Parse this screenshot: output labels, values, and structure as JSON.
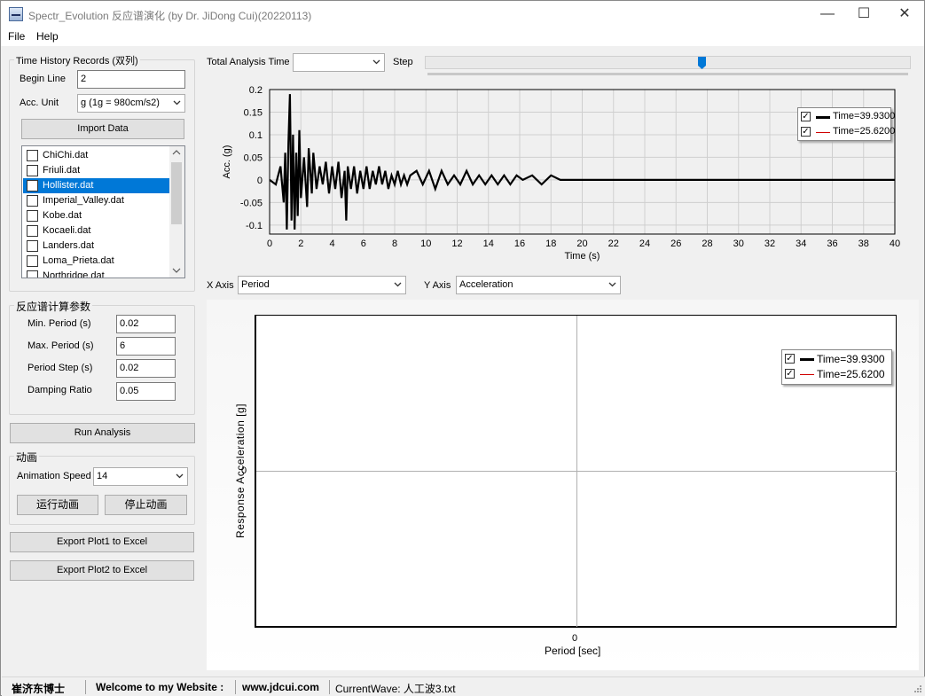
{
  "window": {
    "title": "Spectr_Evolution 反应谱演化 (by Dr. JiDong Cui)(20220113)",
    "controls": {
      "minimize": "—",
      "maximize": "☐",
      "close": "✕"
    }
  },
  "menu": {
    "items": [
      "File",
      "Help"
    ]
  },
  "time_history": {
    "group_title": "Time History Records (双列)",
    "begin_line_label": "Begin Line",
    "begin_line_value": "2",
    "acc_unit_label": "Acc. Unit",
    "acc_unit_value": "g (1g = 980cm/s2)",
    "import_button": "Import Data",
    "files": [
      {
        "name": "ChiChi.dat",
        "checked": false,
        "selected": false
      },
      {
        "name": "Friuli.dat",
        "checked": false,
        "selected": false
      },
      {
        "name": "Hollister.dat",
        "checked": false,
        "selected": true
      },
      {
        "name": "Imperial_Valley.dat",
        "checked": false,
        "selected": false
      },
      {
        "name": "Kobe.dat",
        "checked": false,
        "selected": false
      },
      {
        "name": "Kocaeli.dat",
        "checked": false,
        "selected": false
      },
      {
        "name": "Landers.dat",
        "checked": false,
        "selected": false
      },
      {
        "name": "Loma_Prieta.dat",
        "checked": false,
        "selected": false
      },
      {
        "name": "Northridge.dat",
        "checked": false,
        "selected": false
      }
    ]
  },
  "params": {
    "group_title": "反应谱计算参数",
    "min_period_label": "Min. Period (s)",
    "min_period_value": "0.02",
    "max_period_label": "Max. Period (s)",
    "max_period_value": "6",
    "period_step_label": "Period Step  (s)",
    "period_step_value": "0.02",
    "damping_label": "Damping Ratio",
    "damping_value": "0.05"
  },
  "run_button": "Run Analysis",
  "animation": {
    "group_title": "动画",
    "speed_label": "Animation Speed",
    "speed_value": "14",
    "run_button": "运行动画",
    "stop_button": "停止动画"
  },
  "export": {
    "plot1_button": "Export Plot1 to Excel",
    "plot2_button": "Export Plot2 to Excel"
  },
  "top_controls": {
    "total_time_label": "Total Analysis Time",
    "total_time_value": "",
    "step_label": "Step",
    "step_position": 0.57
  },
  "axis_selectors": {
    "x_label": "X Axis",
    "x_value": "Period",
    "y_label": "Y Axis",
    "y_value": "Acceleration"
  },
  "chart_data": [
    {
      "type": "line",
      "title": "",
      "xlabel": "Time (s)",
      "ylabel": "Acc. (g)",
      "xlim": [
        0,
        40
      ],
      "ylim": [
        -0.12,
        0.2
      ],
      "x_ticks": [
        "0",
        "2",
        "4",
        "6",
        "8",
        "10",
        "12",
        "14",
        "16",
        "18",
        "20",
        "22",
        "24",
        "26",
        "28",
        "30",
        "32",
        "34",
        "36",
        "38",
        "40"
      ],
      "y_ticks": [
        "0.2",
        "0.15",
        "0.1",
        "0.05",
        "0",
        "-0.05",
        "-0.1"
      ],
      "grid": true,
      "legend_position": "top-right",
      "series": [
        {
          "name": "Time=39.9300",
          "color": "#000000",
          "points": [
            [
              0,
              0
            ],
            [
              0.4,
              -0.01
            ],
            [
              0.7,
              0.03
            ],
            [
              0.9,
              -0.05
            ],
            [
              1.0,
              0.06
            ],
            [
              1.1,
              -0.11
            ],
            [
              1.2,
              0.08
            ],
            [
              1.3,
              0.19
            ],
            [
              1.4,
              -0.09
            ],
            [
              1.5,
              0.1
            ],
            [
              1.6,
              -0.11
            ],
            [
              1.7,
              0.06
            ],
            [
              1.8,
              -0.08
            ],
            [
              1.9,
              0.11
            ],
            [
              2.0,
              -0.04
            ],
            [
              2.2,
              0.05
            ],
            [
              2.4,
              -0.06
            ],
            [
              2.5,
              0.07
            ],
            [
              2.7,
              -0.03
            ],
            [
              2.8,
              0.06
            ],
            [
              3.0,
              -0.02
            ],
            [
              3.2,
              0.03
            ],
            [
              3.4,
              -0.01
            ],
            [
              3.6,
              0.04
            ],
            [
              3.8,
              -0.03
            ],
            [
              4.0,
              0.03
            ],
            [
              4.2,
              -0.02
            ],
            [
              4.4,
              0.04
            ],
            [
              4.6,
              -0.04
            ],
            [
              4.8,
              0.02
            ],
            [
              4.9,
              -0.09
            ],
            [
              5.0,
              0.03
            ],
            [
              5.2,
              -0.02
            ],
            [
              5.4,
              0.03
            ],
            [
              5.6,
              -0.03
            ],
            [
              5.8,
              0.02
            ],
            [
              6.0,
              -0.02
            ],
            [
              6.2,
              0.03
            ],
            [
              6.4,
              -0.02
            ],
            [
              6.6,
              0.02
            ],
            [
              6.8,
              -0.01
            ],
            [
              7.0,
              0.03
            ],
            [
              7.2,
              -0.01
            ],
            [
              7.4,
              0.02
            ],
            [
              7.6,
              -0.02
            ],
            [
              7.8,
              0.01
            ],
            [
              8.0,
              -0.01
            ],
            [
              8.2,
              0.02
            ],
            [
              8.4,
              -0.01
            ],
            [
              8.6,
              0.01
            ],
            [
              8.8,
              -0.01
            ],
            [
              9.0,
              0.01
            ],
            [
              9.4,
              0.02
            ],
            [
              9.8,
              -0.01
            ],
            [
              10.2,
              0.02
            ],
            [
              10.6,
              -0.02
            ],
            [
              11.0,
              0.02
            ],
            [
              11.4,
              -0.01
            ],
            [
              11.8,
              0.01
            ],
            [
              12.2,
              -0.01
            ],
            [
              12.6,
              0.02
            ],
            [
              13.0,
              -0.01
            ],
            [
              13.4,
              0.01
            ],
            [
              13.8,
              -0.01
            ],
            [
              14.2,
              0.01
            ],
            [
              14.6,
              -0.01
            ],
            [
              15.0,
              0.01
            ],
            [
              15.4,
              -0.01
            ],
            [
              15.8,
              0.01
            ],
            [
              16.2,
              0
            ],
            [
              16.8,
              0.01
            ],
            [
              17.4,
              -0.01
            ],
            [
              18.0,
              0.01
            ],
            [
              18.6,
              0
            ],
            [
              19.2,
              0
            ],
            [
              20.0,
              0
            ],
            [
              21.0,
              0
            ],
            [
              22.0,
              0
            ],
            [
              23.0,
              0
            ],
            [
              24.0,
              0
            ],
            [
              25.0,
              0
            ],
            [
              26.0,
              0
            ],
            [
              27.0,
              0
            ],
            [
              28.0,
              0
            ],
            [
              29.0,
              0
            ],
            [
              30.0,
              0
            ],
            [
              31.0,
              0
            ],
            [
              32.0,
              0
            ],
            [
              33.0,
              0
            ],
            [
              34.0,
              0
            ],
            [
              35.0,
              0
            ],
            [
              36.0,
              0
            ],
            [
              37.0,
              0
            ],
            [
              38.0,
              0
            ],
            [
              39.0,
              0
            ],
            [
              40.0,
              0
            ]
          ]
        },
        {
          "name": "Time=25.6200",
          "color": "#d00000",
          "points": []
        }
      ]
    },
    {
      "type": "line",
      "title": "",
      "xlabel": "Period [sec]",
      "ylabel": "Response Acceleration [g]",
      "x_ticks": [
        "0"
      ],
      "y_ticks": [
        "0"
      ],
      "grid": true,
      "legend_position": "top-right",
      "series": [
        {
          "name": "Time=39.9300",
          "color": "#000000",
          "points": []
        },
        {
          "name": "Time=25.6200",
          "color": "#d00000",
          "points": []
        }
      ]
    }
  ],
  "status": {
    "author": "崔济东博士",
    "welcome": "Welcome to my Website :",
    "website": "www.jdcui.com",
    "current_wave": "CurrentWave: 人工波3.txt"
  },
  "icons": [
    "app-icon",
    "dropdown-arrow-icon",
    "checkbox-icon",
    "size-grip-icon"
  ]
}
